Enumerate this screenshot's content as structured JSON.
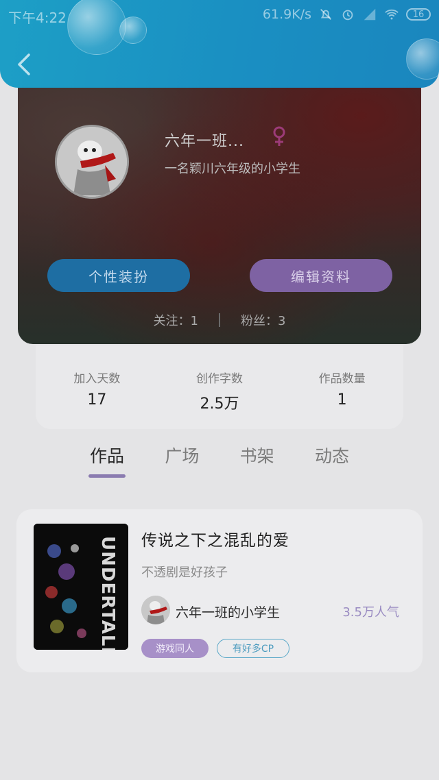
{
  "status_bar": {
    "time": "下午4:22",
    "network_speed": "61.9K/s",
    "battery": "16"
  },
  "profile": {
    "username": "六年一班...",
    "bio": "一名颖川六年级的小学生",
    "dress_up_label": "个性装扮",
    "edit_label": "编辑资料",
    "following": "关注：1",
    "followers": "粉丝：3"
  },
  "stats": [
    {
      "label": "加入天数",
      "value": "17"
    },
    {
      "label": "创作字数",
      "value": "2.5万"
    },
    {
      "label": "作品数量",
      "value": "1"
    }
  ],
  "tabs": [
    {
      "label": "作品",
      "active": true
    },
    {
      "label": "广场",
      "active": false
    },
    {
      "label": "书架",
      "active": false
    },
    {
      "label": "动态",
      "active": false
    }
  ],
  "work": {
    "title": "传说之下之混乱的爱",
    "description": "不透剧是好孩子",
    "author": "六年一班的小学生",
    "popularity": "3.5万人气",
    "cover_text": "UNDERTALE",
    "tags": [
      "游戏同人",
      "有好多CP"
    ]
  },
  "colors": {
    "header": "#1a8fc2",
    "accent_purple": "#8a7bb0",
    "dress_up_button": "#1e6ea3",
    "edit_button": "#7e62a3"
  }
}
